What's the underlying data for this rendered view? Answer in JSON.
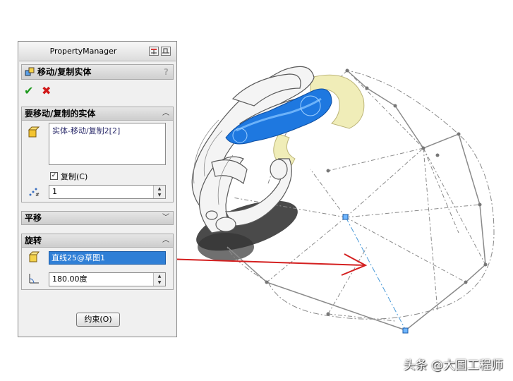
{
  "panel": {
    "title": "PropertyManager",
    "feature_title": "移动/复制实体",
    "help": "?",
    "ok_icon": "checkmark-icon",
    "cancel_icon": "x-icon"
  },
  "move_group": {
    "title": "要移动/复制的实体",
    "selected_body": "实体-移动/复制2[2]",
    "copy_label": "复制(C)",
    "copy_checked": true,
    "copy_count": "1"
  },
  "translate_group": {
    "title": "平移"
  },
  "rotate_group": {
    "title": "旋转",
    "axis_value": "直线25@草图1",
    "angle_value": "180.00度"
  },
  "constraint_button": "约束(O)",
  "watermark": "头条 @大国工程师",
  "colors": {
    "selection": "#2f7fd6",
    "annotation_arrow": "#d42020",
    "highlight_body": "#1e78e0",
    "sketch_lines": "#8a8a8a"
  }
}
